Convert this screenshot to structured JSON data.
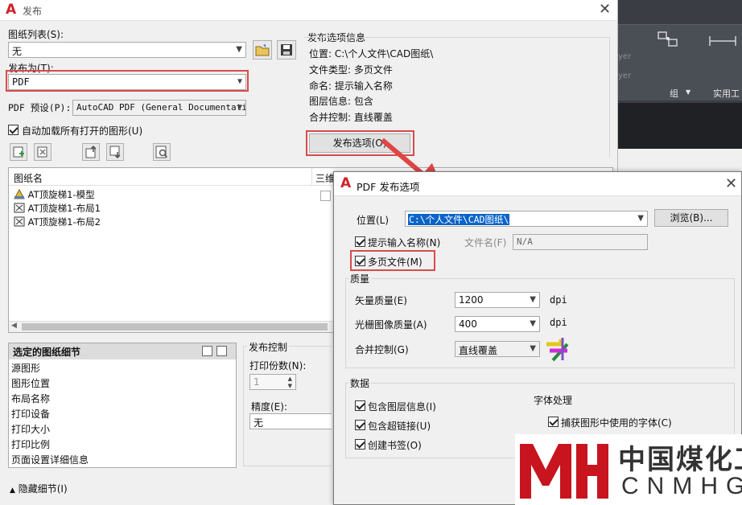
{
  "publish_dialog": {
    "title": "发布",
    "close_glyph": "✕",
    "sheet_list_label": "图纸列表(S):",
    "sheet_list_value": "无",
    "publish_to_label": "发布为(T):",
    "publish_to_value": "PDF",
    "pdf_preset_label": "PDF 预设(P):",
    "pdf_preset_value": "AutoCAD PDF (General Documentatio",
    "auto_load_label": "自动加载所有打开的图形(U)",
    "info_title": "发布选项信息",
    "info_location": "位置: C:\\个人文件\\CAD图纸\\",
    "info_filetype": "文件类型: 多页文件",
    "info_naming": "命名: 提示输入名称",
    "info_layers": "图层信息: 包含",
    "info_merge": "合并控制: 直线覆盖",
    "publish_options_button": "发布选项(O)",
    "list_header_name": "图纸名",
    "list_header_3d": "三维",
    "sheets": [
      {
        "name": "AT顶旋梯1-模型"
      },
      {
        "name": "AT顶旋梯1-布局1"
      },
      {
        "name": "AT顶旋梯1-布局2"
      }
    ],
    "details_title": "选定的图纸细节",
    "details_items": [
      "源图形",
      "图形位置",
      "布局名称",
      "打印设备",
      "打印大小",
      "打印比例",
      "页面设置详细信息"
    ],
    "publish_control_title": "发布控制",
    "copies_label": "打印份数(N):",
    "copies_value": "1",
    "precision_label": "精度(E):",
    "precision_value": "无",
    "hide_details": "隐藏细节(I)"
  },
  "cad_background": {
    "ribbon_labels": [
      "组",
      "实用工"
    ],
    "faded_labels": [
      "yer",
      "yer"
    ]
  },
  "pdf_options": {
    "title": "PDF 发布选项",
    "close_glyph": "✕",
    "location_label": "位置(L)",
    "location_value": "C:\\个人文件\\CAD图纸\\",
    "browse_button": "浏览(B)...",
    "prompt_name_label": "提示输入名称(N)",
    "filename_label": "文件名(F)",
    "filename_value": "N/A",
    "multipage_label": "多页文件(M)",
    "quality_group": "质量",
    "vector_label": "矢量质量(E)",
    "vector_value": "1200",
    "vector_unit": "dpi",
    "raster_label": "光栅图像质量(A)",
    "raster_value": "400",
    "raster_unit": "dpi",
    "merge_label": "合并控制(G)",
    "merge_value": "直线覆盖",
    "data_group": "数据",
    "include_layers": "包含图层信息(I)",
    "include_hyperlinks": "包含超链接(U)",
    "create_bookmarks": "创建书签(O)",
    "font_group": "字体处理",
    "capture_fonts": "捕获图形中使用的字体(C)"
  },
  "watermark": {
    "cn_text": "中国煤化工",
    "en_text": "CNMHG"
  },
  "colors": {
    "highlight_red": "#d94b4b",
    "arrow_red": "#e04545",
    "selection_blue": "#0a64c8",
    "watermark_red": "#c8141e"
  }
}
